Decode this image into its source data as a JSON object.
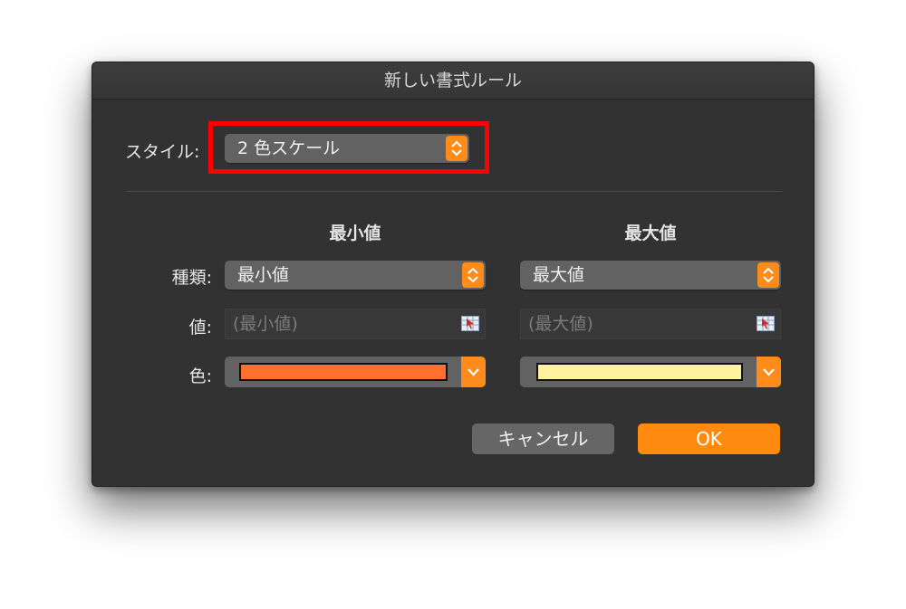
{
  "window": {
    "title": "新しい書式ルール"
  },
  "style": {
    "label": "スタイル:",
    "value": "2 色スケール"
  },
  "columns": {
    "min_header": "最小値",
    "max_header": "最大値"
  },
  "type_row": {
    "label": "種類:",
    "min_value": "最小値",
    "max_value": "最大値"
  },
  "value_row": {
    "label": "値:",
    "min_placeholder": "(最小値)",
    "max_placeholder": "(最大値)"
  },
  "color_row": {
    "label": "色:",
    "min_color": "#ff7030",
    "max_color": "#fff3a0"
  },
  "buttons": {
    "cancel": "キャンセル",
    "ok": "OK"
  },
  "colors": {
    "accent": "#ff8c1a",
    "highlight_box": "#ff0000"
  }
}
